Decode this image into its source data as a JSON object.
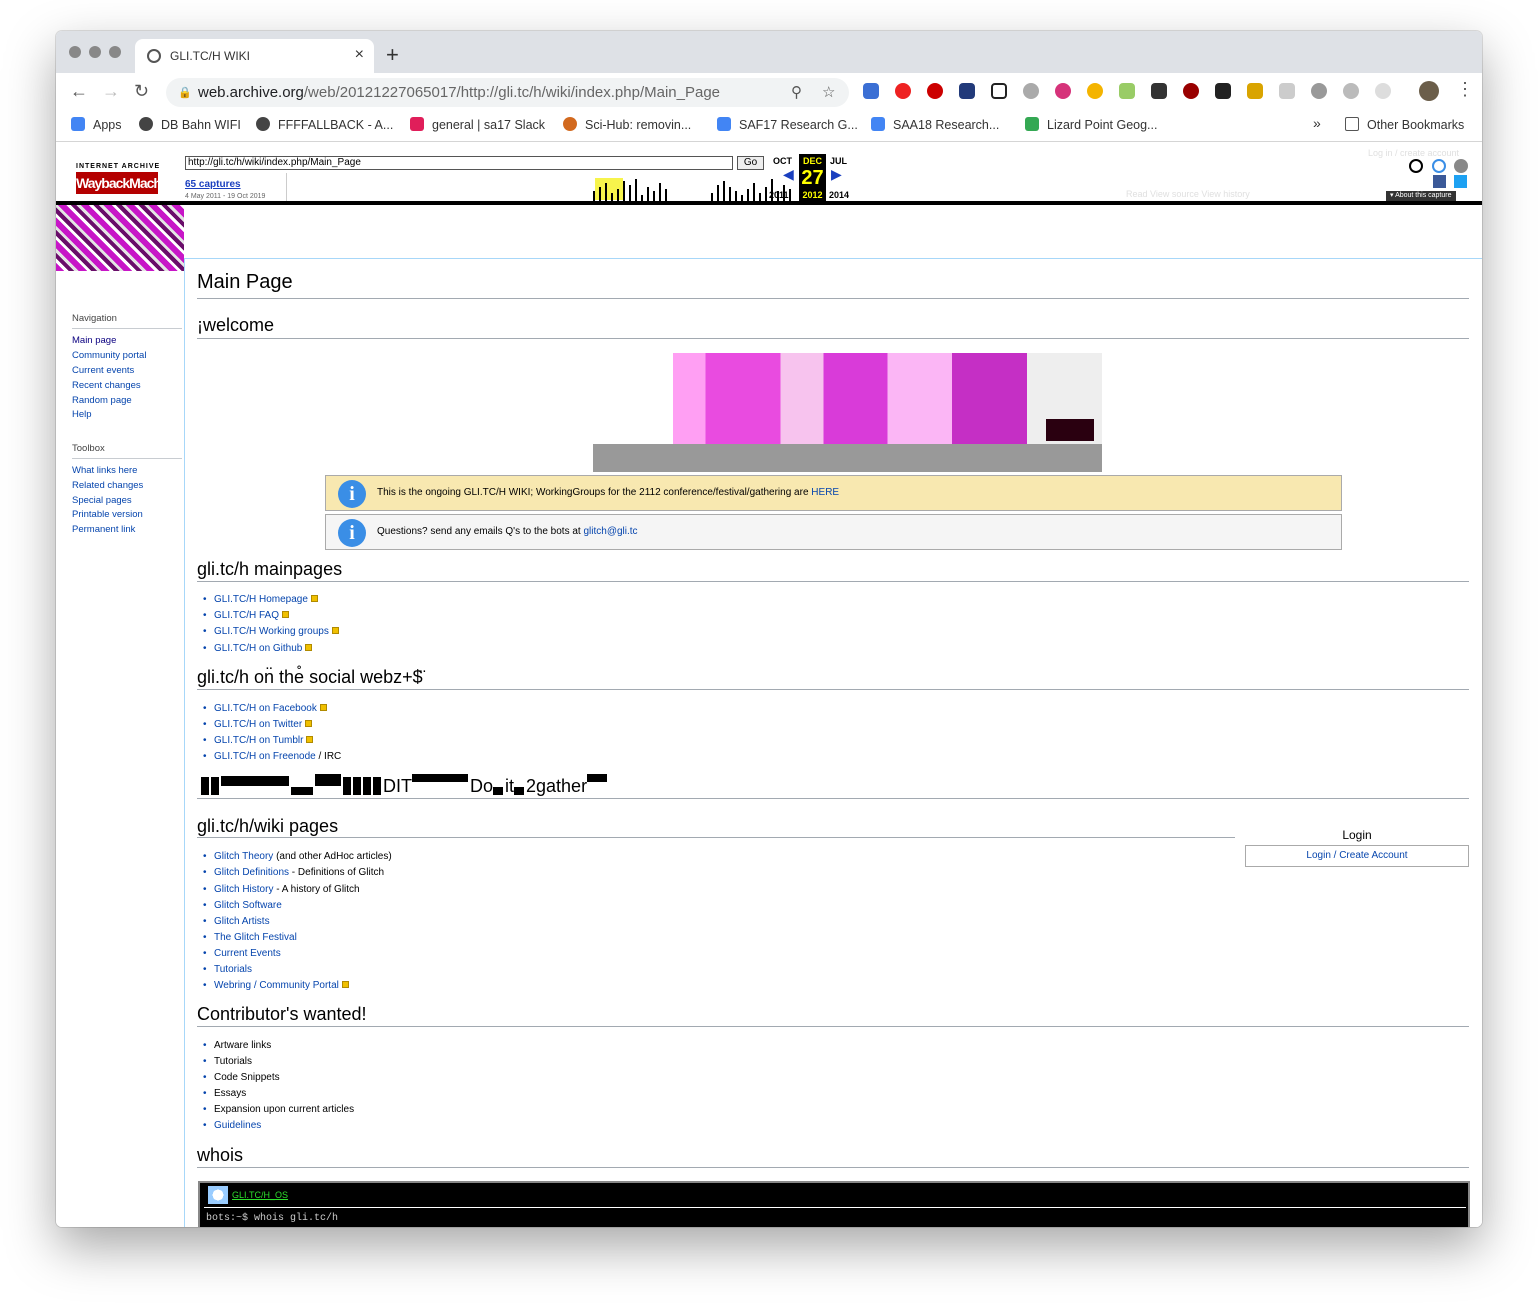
{
  "browser": {
    "tab_title": "GLI.TC/H WIKI",
    "tab_close": "×",
    "new_tab": "+",
    "url_host": "web.archive.org",
    "url_path": "/web/20121227065017/http://gli.tc/h/wiki/index.php/Main_Page",
    "bookmarks": [
      {
        "label": "Apps",
        "color": "#4285f4"
      },
      {
        "label": "DB Bahn WIFI",
        "color": "#444444"
      },
      {
        "label": "FFFFALLBACK - A...",
        "color": "#444444"
      },
      {
        "label": "general | sa17 Slack",
        "color": "#e01e5a"
      },
      {
        "label": "Sci-Hub: removin...",
        "color": "#d2691e"
      },
      {
        "label": "SAF17 Research G...",
        "color": "#4285f4"
      },
      {
        "label": "SAA18 Research...",
        "color": "#4285f4"
      },
      {
        "label": "Lizard Point Geog...",
        "color": "#34a853"
      }
    ],
    "bookmarks_more": "»",
    "other_bookmarks": "Other Bookmarks"
  },
  "wayback": {
    "logo_top": "INTERNET ARCHIVE",
    "logo_mark": "WaybackMachine",
    "url_value": "http://gli.tc/h/wiki/index.php/Main_Page",
    "go": "Go",
    "captures": "65 captures",
    "range": "4 May 2011 - 19 Oct 2019",
    "month_prev": "OCT",
    "month_cur": "DEC",
    "month_next": "JUL",
    "day": "27",
    "year_prev": "2011",
    "year_cur": "2012",
    "year_next": "2014",
    "about": "▾ About this capture",
    "faint_login": "Log in / create account",
    "faint_tabs": "Read   View source   View history"
  },
  "sidebar": {
    "navigation_heading": "Navigation",
    "navigation": [
      "Main page",
      "Community portal",
      "Current events",
      "Recent changes",
      "Random page",
      "Help"
    ],
    "toolbox_heading": "Toolbox",
    "toolbox": [
      "What links here",
      "Related changes",
      "Special pages",
      "Printable version",
      "Permanent link"
    ]
  },
  "content": {
    "title": "Main Page",
    "welcome": "¡welcome",
    "notice1_text": "This is the ongoing GLI.TC/H WIKI; WorkingGroups for the 2112 conference/festival/gathering are ",
    "notice1_link": "HERE",
    "notice2_text": "Questions? send any emails Q's to the bots at ",
    "notice2_link": "glitch@gli.tc",
    "mainpages_heading": "gli.tc/h mainpages",
    "mainpages": [
      "GLI.TC/H Homepage",
      "GLI.TC/H FAQ",
      "GLI.TC/H Working groups",
      "GLI.TC/H on Github"
    ],
    "social_heading": "gli.tc/h on̈ the̊ social webz+$̈",
    "social": [
      "GLI.TC/H on Facebook",
      "GLI.TC/H on Twitter",
      "GLI.TC/H on Tumblr",
      "GLI.TC/H on Freenode"
    ],
    "social_irc": " / IRC",
    "glitch_heading_1": "DIT",
    "glitch_heading_2": "Do",
    "glitch_heading_3": "it",
    "glitch_heading_4": "2gather",
    "wiki_heading": "gli.tc/h/wiki pages",
    "login_title": "Login",
    "login_button": "Login / Create Account",
    "wiki_pages": [
      {
        "link": "Glitch Theory",
        "rest": " (and other AdHoc articles)"
      },
      {
        "link": "Glitch Definitions",
        "rest": " - Definitions of Glitch"
      },
      {
        "link": "Glitch History",
        "rest": " - A history of Glitch"
      },
      {
        "link": "Glitch Software",
        "rest": ""
      },
      {
        "link": "Glitch Artists",
        "rest": ""
      },
      {
        "link": "The Glitch Festival",
        "rest": ""
      },
      {
        "link": "Current Events",
        "rest": ""
      },
      {
        "link": "Tutorials",
        "rest": ""
      },
      {
        "link": "Webring / Community Portal",
        "rest": ""
      }
    ],
    "contrib_heading": "Contributor's wanted!",
    "contrib": [
      "Artware links",
      "Tutorials",
      "Code Snippets",
      "Essays",
      "Expansion upon current articles"
    ],
    "contrib_link": "Guidelines",
    "whois_heading": "whois",
    "terminal_title": "GLI.TC/H_OS",
    "terminal_line": "bots:~$ whois gli.tc/h"
  }
}
